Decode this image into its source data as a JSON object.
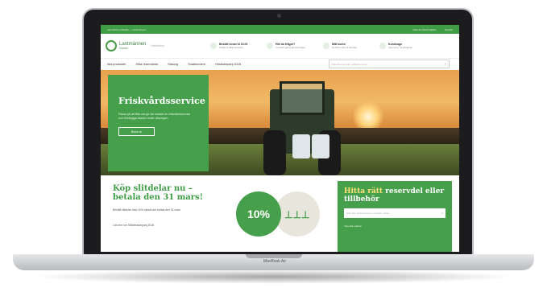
{
  "device": {
    "brand_label": "MacBook Air"
  },
  "site": {
    "topbar": {
      "left": "Lantmännen Maskin — Lantmännen",
      "right_1": "Hitta din återförsäljare",
      "right_2": "Kontakt"
    },
    "logo": {
      "name": "Lantmännen",
      "sub": "Maskin",
      "tag": "Webbshop"
    },
    "usps": [
      {
        "title": "Beställ innan kl 15.00",
        "sub": "Snabb & säker leverans"
      },
      {
        "title": "Hitt du frågor?",
        "sub": "Vi svarar gärna på dina frågor"
      },
      {
        "title": "Mitt konto",
        "sub": "Se dina ordrar & favoriter"
      },
      {
        "title": "Kundvagn",
        "sub": "Inga varor i kundvagnen"
      }
    ],
    "nav": [
      "Alla produkter",
      "Hitta reservdelar",
      "Säsong",
      "Snabbordern",
      "Höstkampanj 2018"
    ],
    "search_placeholder": "Sök efter produkt, artikelnummer..."
  },
  "hero": {
    "title": "Friskvårdsservice",
    "text": "Passa på att låta oss ge din maskin en friskvårdsservice och förebygga skador under säsongen.",
    "button": "Boka nu"
  },
  "promo": {
    "title": "Köp slitdelar nu – betala den 31 mars!",
    "text": "Beställ slitdelar med 10% rabatt och betala den 31 mars.",
    "link": "Läs mer om Slitdelskampanj 2018",
    "badge": "10%"
  },
  "finder": {
    "title_highlight": "Hitta rätt",
    "title_rest": " reservdel eller tillbehör",
    "search_placeholder": "Sök efter artikelnummer, produkt, märke...",
    "link": "Visa alla märken"
  }
}
